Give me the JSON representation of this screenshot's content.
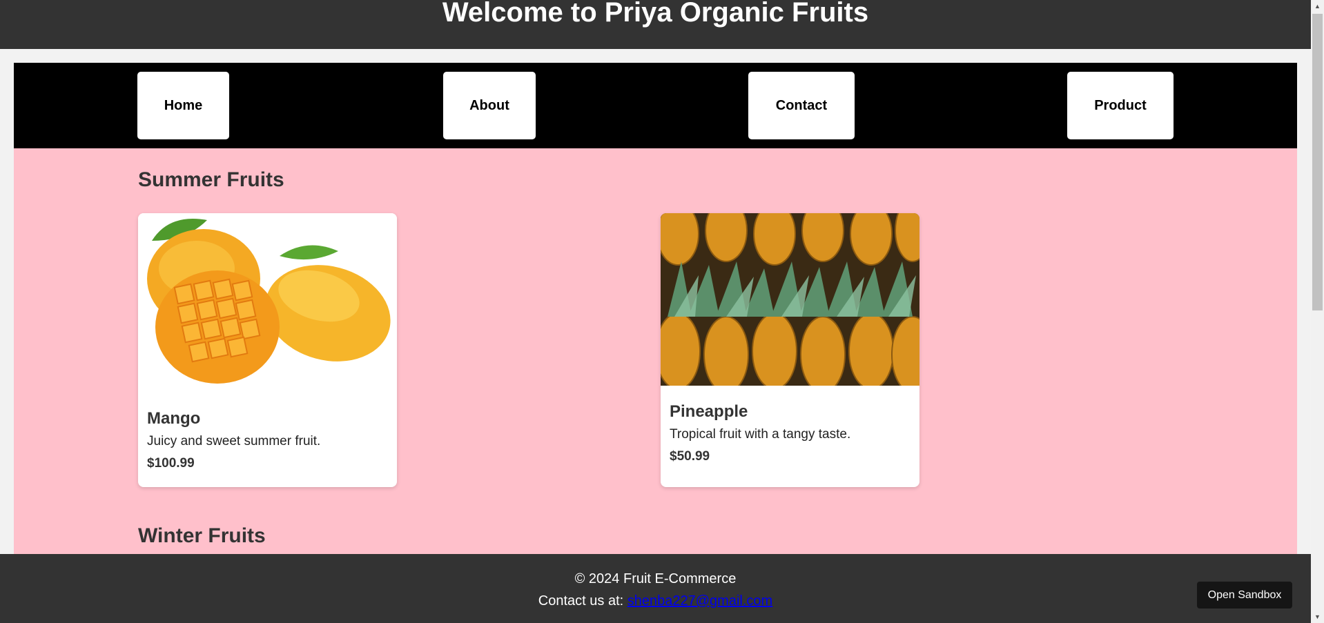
{
  "header": {
    "title": "Welcome to Priya Organic Fruits"
  },
  "nav": {
    "items": [
      {
        "label": "Home"
      },
      {
        "label": "About"
      },
      {
        "label": "Contact"
      },
      {
        "label": "Product"
      }
    ]
  },
  "sections": [
    {
      "title": "Summer Fruits",
      "products": [
        {
          "name": "Mango",
          "description": "Juicy and sweet summer fruit.",
          "price": "$100.99",
          "image": "mango-photo"
        },
        {
          "name": "Pineapple",
          "description": "Tropical fruit with a tangy taste.",
          "price": "$50.99",
          "image": "pineapple-photo"
        }
      ]
    },
    {
      "title": "Winter Fruits"
    }
  ],
  "footer": {
    "copyright": "© 2024 Fruit E-Commerce",
    "contact_prefix": "Contact us at: ",
    "email": "shenba227@gmail.com"
  },
  "sandbox_button": "Open Sandbox",
  "colors": {
    "header_bg": "#333333",
    "nav_bg": "#000000",
    "main_bg": "#ffc0cb",
    "link": "#0000ee"
  }
}
